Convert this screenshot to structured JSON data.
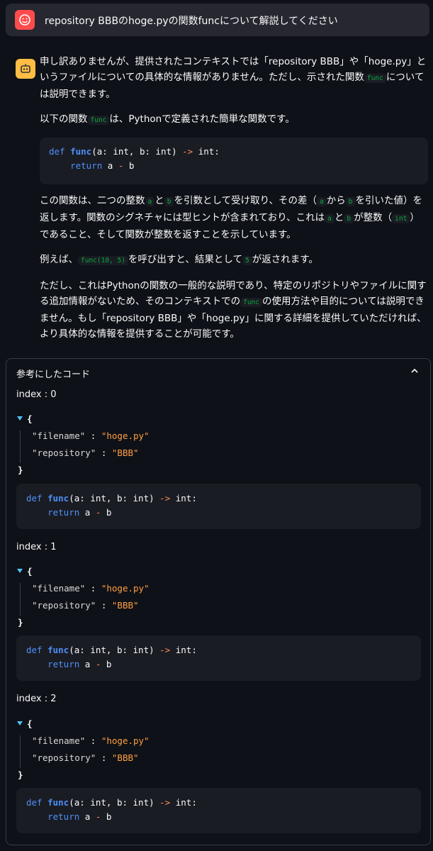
{
  "user_message": {
    "text": "repository BBBのhoge.pyの関数funcについて解説してください"
  },
  "assistant": {
    "p1_a": "申し訳ありませんが、提供されたコンテキストでは「repository BBB」や「hoge.py」というファイルについての具体的な情報がありません。ただし、示された関数",
    "p1_code": "func",
    "p1_b": "については説明できます。",
    "p2_a": "以下の関数",
    "p2_code": "func",
    "p2_b": "は、Pythonで定義された簡単な関数です。",
    "code": {
      "kw_def": "def",
      "fn_name": "func",
      "params": "(a: int, b: int) ",
      "arrow": "->",
      "ret_type": " int:",
      "indent": "    ",
      "kw_return": "return",
      "expr_a": " a ",
      "minus": "-",
      "expr_b": " b"
    },
    "p3_a": "この関数は、二つの整数",
    "p3_code_a": "a",
    "p3_b": "と",
    "p3_code_b": "b",
    "p3_c": "を引数として受け取り、その差（",
    "p3_code_c": "a",
    "p3_d": "から",
    "p3_code_d": "b",
    "p3_e": "を引いた値）を返します。関数のシグネチャには型ヒントが含まれており、これは",
    "p3_code_e": "a",
    "p3_f": "と",
    "p3_code_f": "b",
    "p3_g": "が整数（",
    "p3_code_g": "int",
    "p3_h": "）であること、そして関数が整数を返すことを示しています。",
    "p4_a": "例えば、",
    "p4_code_a": "func(10, 5)",
    "p4_b": "を呼び出すと、結果として",
    "p4_code_b": "5",
    "p4_c": "が返されます。",
    "p5_a": "ただし、これはPythonの関数の一般的な説明であり、特定のリポジトリやファイルに関する追加情報がないため、そのコンテキストでの",
    "p5_code": "func",
    "p5_b": "の使用方法や目的については説明できません。もし「repository BBB」や「hoge.py」に関する詳細を提供していただければ、より具体的な情報を提供することが可能です。"
  },
  "references": {
    "title": "参考にしたコード",
    "collapse_icon": "chevron-up-icon",
    "json_open": "{",
    "json_close": "}",
    "key_filename": "\"filename\"",
    "key_repository": "\"repository\"",
    "colon": " : ",
    "items": [
      {
        "index_label": "index : 0",
        "filename": "\"hoge.py\"",
        "repository": "\"BBB\""
      },
      {
        "index_label": "index : 1",
        "filename": "\"hoge.py\"",
        "repository": "\"BBB\""
      },
      {
        "index_label": "index : 2",
        "filename": "\"hoge.py\"",
        "repository": "\"BBB\""
      }
    ]
  },
  "colors": {
    "background": "#0e1117",
    "user_avatar": "#ff4b4b",
    "bot_avatar": "#ffbd45",
    "inline_code": "#09ab3b",
    "keyword": "#4f8ff7",
    "string_value": "#ff9f43"
  }
}
